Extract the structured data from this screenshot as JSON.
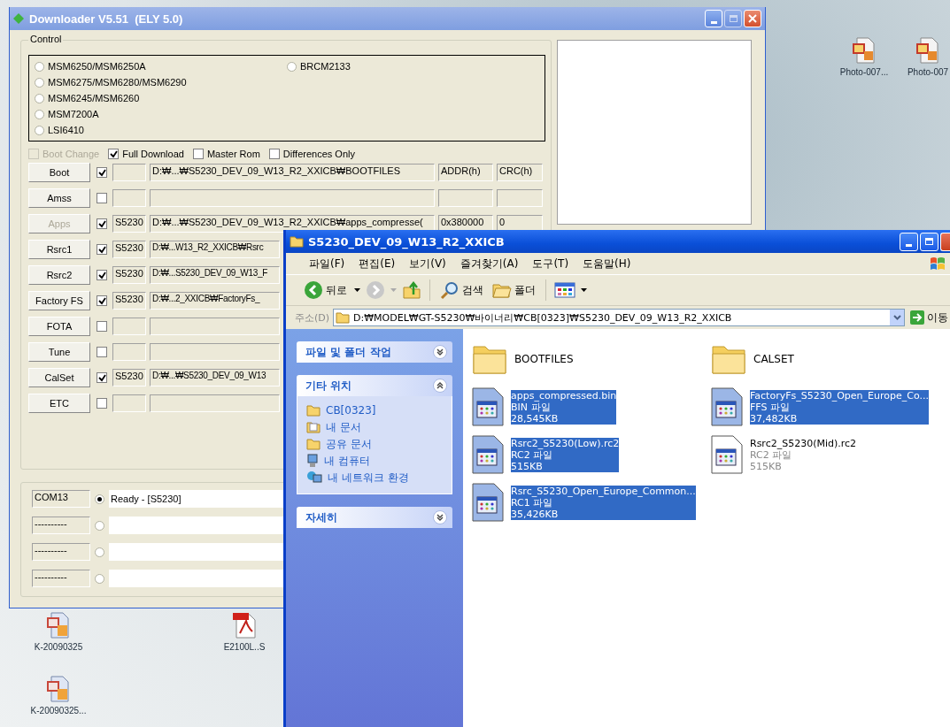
{
  "downloader": {
    "title": "Downloader V5.51  (ELY 5.0)",
    "group_label": "Control",
    "chips_left": [
      {
        "label": "MSM6250/MSM6250A",
        "selected": false
      },
      {
        "label": "MSM6275/MSM6280/MSM6290",
        "selected": false
      },
      {
        "label": "MSM6245/MSM6260",
        "selected": false
      },
      {
        "label": "MSM7200A",
        "selected": false
      },
      {
        "label": "LSI6410",
        "selected": false
      }
    ],
    "chips_right": [
      {
        "label": "BRCM2133",
        "selected": false
      }
    ],
    "options": [
      {
        "label": "Boot Change",
        "checked": false,
        "disabled": true
      },
      {
        "label": "Full Download",
        "checked": true,
        "disabled": false
      },
      {
        "label": "Master Rom",
        "checked": false,
        "disabled": false
      },
      {
        "label": "Differences Only",
        "checked": false,
        "disabled": false
      }
    ],
    "rows": [
      {
        "kind": "wide",
        "button": "Boot",
        "disabled": false,
        "checked": true,
        "path": "D:₩...₩S5230_DEV_09_W13_R2_XXICB₩BOOTFILES",
        "addr": "ADDR(h)",
        "crc": "CRC(h)"
      },
      {
        "kind": "wide",
        "button": "Amss",
        "disabled": false,
        "checked": false
      },
      {
        "kind": "wide",
        "button": "Apps",
        "disabled": true,
        "checked": true,
        "model": "S5230",
        "path": "D:₩...₩S5230_DEV_09_W13_R2_XXICB₩apps_compresse(",
        "addr": "0x380000",
        "crc": "0"
      },
      {
        "kind": "narrow",
        "button": "Rsrc1",
        "disabled": false,
        "checked": true,
        "model": "S5230",
        "path": "D:₩...W13_R2_XXICB₩Rsrc"
      },
      {
        "kind": "narrow",
        "button": "Rsrc2",
        "disabled": false,
        "checked": true,
        "model": "S5230",
        "path": "D:₩...S5230_DEV_09_W13_F"
      },
      {
        "kind": "narrow",
        "button": "Factory FS",
        "disabled": false,
        "checked": true,
        "model": "S5230",
        "path": "D:₩...2_XXICB₩FactoryFs_"
      },
      {
        "kind": "narrow",
        "button": "FOTA",
        "disabled": false,
        "checked": false
      },
      {
        "kind": "narrow",
        "button": "Tune",
        "disabled": false,
        "checked": false
      },
      {
        "kind": "narrow",
        "button": "CalSet",
        "disabled": false,
        "checked": true,
        "model": "S5230",
        "path": "D:₩...₩S5230_DEV_09_W13"
      },
      {
        "kind": "narrow",
        "button": "ETC",
        "disabled": false,
        "checked": false
      }
    ],
    "ports": [
      {
        "port": "COM13",
        "selected": true,
        "status": "Ready - [S5230]"
      },
      {
        "port": "----------",
        "selected": false
      },
      {
        "port": "----------",
        "selected": false
      },
      {
        "port": "----------",
        "selected": false
      }
    ]
  },
  "explorer": {
    "title": "S5230_DEV_09_W13_R2_XXICB",
    "menu": [
      "파일(F)",
      "편집(E)",
      "보기(V)",
      "즐겨찾기(A)",
      "도구(T)",
      "도움말(H)"
    ],
    "toolbar": {
      "back": "뒤로",
      "search": "검색",
      "folders": "폴더"
    },
    "address": {
      "label": "주소(D)",
      "value": "D:₩MODEL₩GT-S5230₩바이너리₩CB[0323]₩S5230_DEV_09_W13_R2_XXICB",
      "go": "이동"
    },
    "panels": [
      {
        "title": "파일 및 폴더 작업",
        "expanded": false
      },
      {
        "title": "기타 위치",
        "expanded": true,
        "links": [
          {
            "label": "CB[0323]",
            "kind": "folder"
          },
          {
            "label": "내 문서",
            "kind": "document"
          },
          {
            "label": "공유 문서",
            "kind": "folder"
          },
          {
            "label": "내 컴퓨터",
            "kind": "computer"
          },
          {
            "label": "내 네트워크 환경",
            "kind": "network"
          }
        ]
      },
      {
        "title": "자세히",
        "expanded": false
      }
    ],
    "files": [
      {
        "kind": "folder",
        "name": "BOOTFILES",
        "selected": false
      },
      {
        "kind": "folder",
        "name": "CALSET",
        "selected": false
      },
      {
        "kind": "file",
        "name": "apps_compressed.bin",
        "type": "BIN 파일",
        "size": "28,545KB",
        "selected": true
      },
      {
        "kind": "file",
        "name": "FactoryFs_S5230_Open_Europe_Co...",
        "type": "FFS 파일",
        "size": "37,482KB",
        "selected": true
      },
      {
        "kind": "file",
        "name": "Rsrc2_S5230(Low).rc2",
        "type": "RC2 파일",
        "size": "515KB",
        "selected": true
      },
      {
        "kind": "file",
        "name": "Rsrc2_S5230(Mid).rc2",
        "type": "RC2 파일",
        "size": "515KB",
        "selected": false
      },
      {
        "kind": "file",
        "name": "Rsrc_S5230_Open_Europe_Common...",
        "type": "RC1 파일",
        "size": "35,426KB",
        "selected": true
      }
    ]
  },
  "desktop_icons": [
    {
      "label": "Photo-007...",
      "kind": "image"
    },
    {
      "label": "Photo-007",
      "kind": "image"
    },
    {
      "label": "K-20090325",
      "kind": "slides"
    },
    {
      "label": "E2100L..S",
      "kind": "pdf"
    },
    {
      "label": "K-20090325...",
      "kind": "slides"
    }
  ]
}
